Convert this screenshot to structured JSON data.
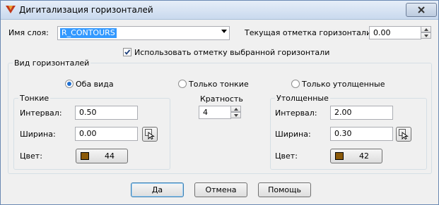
{
  "window": {
    "title": "Дигитализация горизонталей"
  },
  "layer": {
    "label": "Имя слоя:",
    "value": "R_CONTOURS"
  },
  "current_elevation": {
    "label": "Текущая отметка горизонтали:",
    "value": "0.00"
  },
  "use_selected": {
    "label": "Использовать отметку выбранной горизонтали",
    "checked": true
  },
  "view_group": {
    "title": "Вид горизонталей",
    "options": [
      {
        "label": "Оба вида",
        "selected": true
      },
      {
        "label": "Только тонкие",
        "selected": false
      },
      {
        "label": "Только утолщенные",
        "selected": false
      }
    ]
  },
  "thin": {
    "title": "Тонкие",
    "interval_label": "Интервал:",
    "interval": "0.50",
    "width_label": "Ширина:",
    "width": "0.00",
    "color_label": "Цвет:",
    "color_index": "44",
    "color_hex": "#8b5a0a"
  },
  "multiplicity": {
    "label": "Кратность",
    "value": "4"
  },
  "thick": {
    "title": "Утолщенные",
    "interval_label": "Интервал:",
    "interval": "2.00",
    "width_label": "Ширина:",
    "width": "0.30",
    "color_label": "Цвет:",
    "color_index": "42",
    "color_hex": "#8b5a0a"
  },
  "buttons": {
    "ok": "Да",
    "cancel": "Отмена",
    "help": "Помощь"
  }
}
